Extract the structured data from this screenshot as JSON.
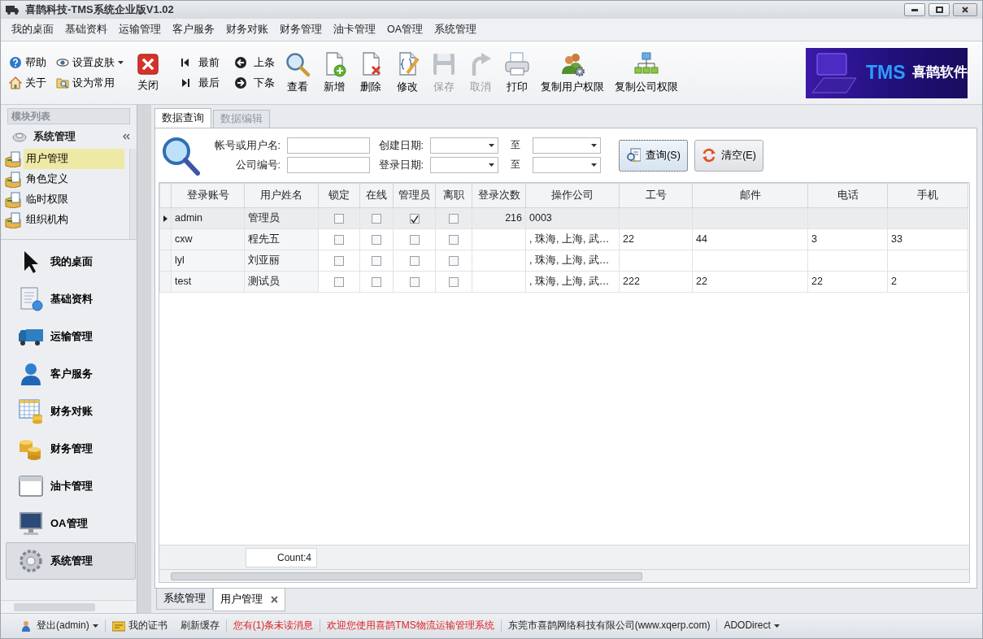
{
  "window": {
    "title": "喜鹊科技-TMS系统企业版V1.02"
  },
  "menu": [
    "我的桌面",
    "基础资料",
    "运输管理",
    "客户服务",
    "财务对账",
    "财务管理",
    "油卡管理",
    "OA管理",
    "系统管理"
  ],
  "toolbar": {
    "quick": [
      {
        "label": "帮助",
        "kind": "help",
        "dropdown": false
      },
      {
        "label": "设置皮肤",
        "kind": "skin",
        "dropdown": true
      },
      {
        "label": "关于",
        "kind": "about",
        "dropdown": false
      },
      {
        "label": "设为常用",
        "kind": "favorite",
        "dropdown": false
      }
    ],
    "close": {
      "label": "关闭"
    },
    "navigation": [
      {
        "label": "最前",
        "kind": "first"
      },
      {
        "label": "上条",
        "kind": "previous"
      },
      {
        "label": "最后",
        "kind": "last"
      },
      {
        "label": "下条",
        "kind": "next"
      }
    ],
    "actions": [
      {
        "label": "查看",
        "kind": "view",
        "disabled": false
      },
      {
        "label": "新增",
        "kind": "add",
        "disabled": false
      },
      {
        "label": "删除",
        "kind": "delete",
        "disabled": false
      },
      {
        "label": "修改",
        "kind": "edit",
        "disabled": false
      },
      {
        "label": "保存",
        "kind": "save",
        "disabled": true
      },
      {
        "label": "取消",
        "kind": "cancel",
        "disabled": true
      },
      {
        "label": "打印",
        "kind": "print",
        "disabled": false
      },
      {
        "label": "复制用户权限",
        "kind": "copy-user",
        "disabled": false
      },
      {
        "label": "复制公司权限",
        "kind": "copy-company",
        "disabled": false
      }
    ]
  },
  "banner": {
    "brand": "TMS",
    "name": "喜鹊软件"
  },
  "sidebar": {
    "header": "模块列表",
    "group": "系统管理",
    "items": [
      {
        "label": "用户管理",
        "selected": true
      },
      {
        "label": "角色定义",
        "selected": false
      },
      {
        "label": "临时权限",
        "selected": false
      },
      {
        "label": "组织机构",
        "selected": false
      }
    ],
    "modules": [
      {
        "label": "我的桌面",
        "kind": "desktop",
        "selected": false
      },
      {
        "label": "基础资料",
        "kind": "basic",
        "selected": false
      },
      {
        "label": "运输管理",
        "kind": "transport",
        "selected": false
      },
      {
        "label": "客户服务",
        "kind": "customer",
        "selected": false
      },
      {
        "label": "财务对账",
        "kind": "reconcile",
        "selected": false
      },
      {
        "label": "财务管理",
        "kind": "finance",
        "selected": false
      },
      {
        "label": "油卡管理",
        "kind": "fuelcard",
        "selected": false
      },
      {
        "label": "OA管理",
        "kind": "oa",
        "selected": false
      },
      {
        "label": "系统管理",
        "kind": "system",
        "selected": true
      }
    ]
  },
  "tabs": [
    {
      "label": "数据查询",
      "selected": true
    },
    {
      "label": "数据编辑",
      "selected": false
    }
  ],
  "query": {
    "fields": [
      {
        "label": "帐号或用户名:"
      },
      {
        "label": "公司编号:"
      }
    ],
    "dates": [
      {
        "label": "创建日期:",
        "to": "至"
      },
      {
        "label": "登录日期:",
        "to": "至"
      }
    ],
    "buttons": [
      {
        "label": "查询(S)",
        "kind": "search"
      },
      {
        "label": "清空(E)",
        "kind": "clear"
      }
    ]
  },
  "table": {
    "columns": [
      "登录账号",
      "用户姓名",
      "锁定",
      "在线",
      "管理员",
      "离职",
      "登录次数",
      "操作公司",
      "工号",
      "邮件",
      "电话",
      "手机"
    ],
    "rows": [
      {
        "selected": true,
        "account": "admin",
        "name": "管理员",
        "locked": false,
        "online": false,
        "admin": true,
        "resigned": false,
        "login_count": "216",
        "company": "0003"
      },
      {
        "selected": false,
        "account": "cxw",
        "name": "程先五",
        "locked": false,
        "online": false,
        "admin": false,
        "resigned": false,
        "company": ", 珠海, 上海, 武…",
        "employee_no": "22",
        "email": "44",
        "phone": "3",
        "mobile": "33"
      },
      {
        "selected": false,
        "account": "lyl",
        "name": "刘亚丽",
        "locked": false,
        "online": false,
        "admin": false,
        "resigned": false,
        "company": ", 珠海, 上海, 武…"
      },
      {
        "selected": false,
        "account": "test",
        "name": "测试员",
        "locked": false,
        "online": false,
        "admin": false,
        "resigned": false,
        "company": ", 珠海, 上海, 武…",
        "employee_no": "222",
        "email": "22",
        "phone": "22",
        "mobile": "2"
      }
    ],
    "count": "Count:4"
  },
  "document_tabs": [
    {
      "label": "系统管理",
      "selected": false,
      "closable": false
    },
    {
      "label": "用户管理",
      "selected": true,
      "closable": true
    }
  ],
  "status_bar": [
    {
      "text": "登出(admin)",
      "kind": "user-menu"
    },
    {
      "text": "我的证书",
      "kind": "certificate"
    },
    {
      "text": "刷新缓存",
      "kind": "action"
    },
    {
      "text": "您有(1)条未读消息",
      "kind": "alert"
    },
    {
      "text": "欢迎您使用喜鹊TMS物流运输管理系统",
      "kind": "notice"
    },
    {
      "text": "东莞市喜鹊网络科技有限公司(www.xqerp.com)",
      "kind": "info"
    },
    {
      "text": "ADODirect",
      "kind": "menu"
    }
  ]
}
